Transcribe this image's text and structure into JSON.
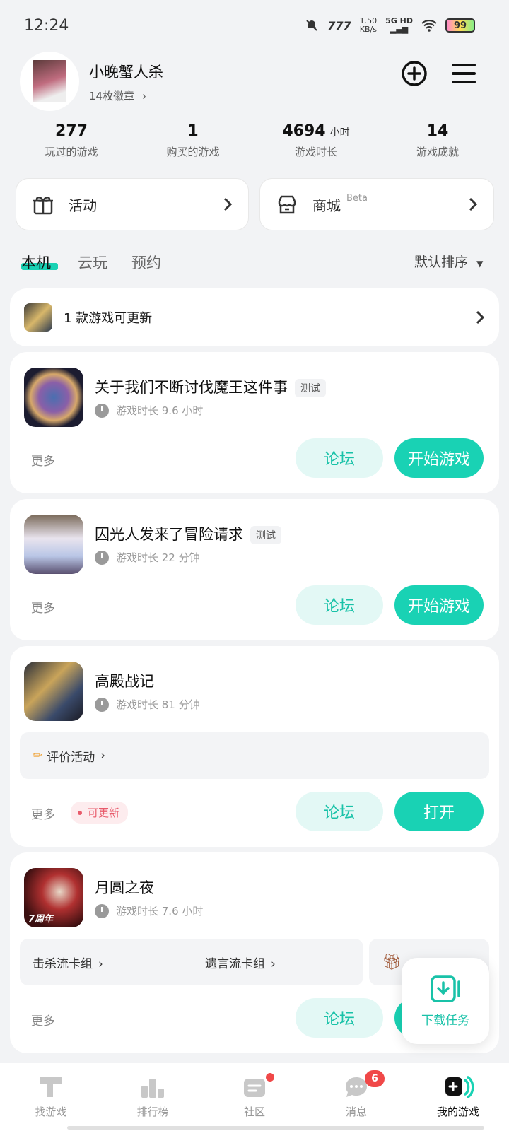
{
  "status_bar": {
    "time": "12:24",
    "network_speed": "1.50",
    "network_unit": "KB/s",
    "network_type": "5G HD",
    "battery": "99"
  },
  "profile": {
    "username": "小晚蟹人杀",
    "badges": "14枚徽章"
  },
  "stats": [
    {
      "value": "277",
      "unit": "",
      "label": "玩过的游戏"
    },
    {
      "value": "1",
      "unit": "",
      "label": "购买的游戏"
    },
    {
      "value": "4694",
      "unit": "小时",
      "label": "游戏时长"
    },
    {
      "value": "14",
      "unit": "",
      "label": "游戏成就"
    }
  ],
  "shortcuts": {
    "activity": "活动",
    "store": "商城",
    "store_tag": "Beta"
  },
  "tabs": {
    "local": "本机",
    "cloud": "云玩",
    "reserve": "预约",
    "sort": "默认排序"
  },
  "update_banner": {
    "text": "1 款游戏可更新"
  },
  "games": [
    {
      "title": "关于我们不断讨伐魔王这件事",
      "tag": "测试",
      "play_time": "游戏时长 9.6 小时",
      "more": "更多",
      "forum": "论坛",
      "action": "开始游戏"
    },
    {
      "title": "囚光人发来了冒险请求",
      "tag": "测试",
      "play_time": "游戏时长 22 分钟",
      "more": "更多",
      "forum": "论坛",
      "action": "开始游戏"
    },
    {
      "title": "高殿战记",
      "play_time": "游戏时长 81 分钟",
      "sub": "评价活动",
      "more": "更多",
      "update_badge": "可更新",
      "forum": "论坛",
      "action": "打开"
    },
    {
      "title": "月圆之夜",
      "icon_caption": "7周年",
      "play_time": "游戏时长 7.6 小时",
      "sub_left": "击杀流卡组",
      "sub_right": "遗言流卡组",
      "more": "更多",
      "forum": "论坛"
    }
  ],
  "floating": {
    "download_tasks": "下载任务"
  },
  "bottom_nav": [
    {
      "label": "找游戏"
    },
    {
      "label": "排行榜"
    },
    {
      "label": "社区"
    },
    {
      "label": "消息",
      "badge": "6"
    },
    {
      "label": "我的游戏"
    }
  ],
  "colors": {
    "accent": "#19d2b4",
    "badge_red": "#f04848"
  }
}
